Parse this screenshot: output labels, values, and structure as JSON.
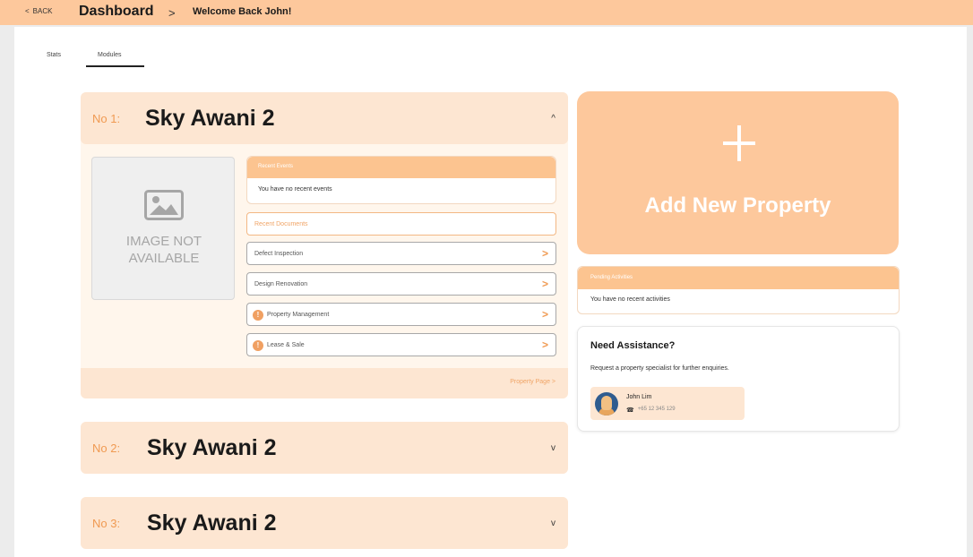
{
  "header": {
    "back_icon": "chevron-left-icon",
    "back_glyph": "<",
    "back_label": "BACK",
    "title": "Dashboard",
    "separator": ">",
    "welcome": "Welcome Back John!"
  },
  "tabs": [
    {
      "label": "Stats",
      "active": false
    },
    {
      "label": "Modules",
      "active": true
    }
  ],
  "properties": [
    {
      "no_label": "No 1:",
      "name": "Sky Awani 2",
      "expanded": true,
      "chevron": "^",
      "image_placeholder": "IMAGE NOT AVAILABLE",
      "image_line1": "IMAGE NOT",
      "image_line2": "AVAILABLE",
      "events_title": "Recent Events",
      "events_text": "You have no recent events",
      "recent_documents": "Recent Documents",
      "modules": [
        {
          "label": "Defect Inspection",
          "alert": false
        },
        {
          "label": "Design Renovation",
          "alert": false
        },
        {
          "label": "Property Management",
          "alert": true
        },
        {
          "label": "Lease & Sale",
          "alert": true
        }
      ],
      "module_chevron": ">",
      "alert_glyph": "!",
      "property_page_link": "Property Page >"
    },
    {
      "no_label": "No 2:",
      "name": "Sky Awani 2",
      "expanded": false,
      "chevron": "v"
    },
    {
      "no_label": "No 3:",
      "name": "Sky Awani 2",
      "expanded": false,
      "chevron": "v"
    }
  ],
  "add_property": {
    "label": "Add New Property",
    "icon": "plus-icon"
  },
  "activities": {
    "title": "Pending Activities",
    "text": "You have no recent activities"
  },
  "assistance": {
    "title": "Need Assistance?",
    "description": "Request a property specialist for further enquiries.",
    "contact": {
      "name": "John Lim",
      "phone": "+65 12 345 129",
      "phone_icon": "phone-icon",
      "phone_glyph": "☎"
    }
  },
  "colors": {
    "accent": "#fdc89c",
    "accent_dark": "#f09a52",
    "card_bg": "#fde6d2"
  }
}
